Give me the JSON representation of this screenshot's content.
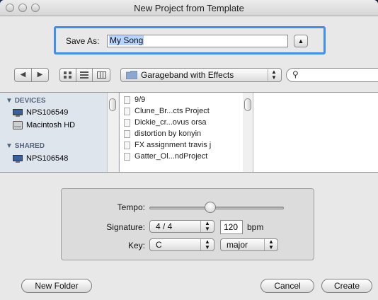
{
  "window": {
    "title": "New Project from Template"
  },
  "save_as": {
    "label": "Save As:",
    "value": "My Song"
  },
  "toolbar": {
    "back_icon": "back-arrow-icon",
    "forward_icon": "forward-arrow-icon",
    "view_icons": [
      "icon-view-icon",
      "list-view-icon",
      "column-view-icon"
    ],
    "location": "Garageband with Effects",
    "search_placeholder": ""
  },
  "sidebar": {
    "devices_header": "DEVICES",
    "devices": [
      "NPS106549",
      "Macintosh HD"
    ],
    "shared_header": "SHARED",
    "shared": [
      "NPS106548"
    ]
  },
  "files": [
    "9/9",
    "Clune_Br...cts Project",
    "Dickie_cr...ovus orsa",
    "distortion by konyin",
    "FX assignment travis j",
    "Gatter_Ol...ndProject"
  ],
  "project_settings": {
    "tempo_label": "Tempo:",
    "tempo_position": 0.45,
    "signature_label": "Signature:",
    "signature": "4 / 4",
    "bpm_value": "120",
    "bpm_unit": "bpm",
    "key_label": "Key:",
    "key": "C",
    "scale": "major"
  },
  "buttons": {
    "new_folder": "New Folder",
    "cancel": "Cancel",
    "create": "Create"
  },
  "colors": {
    "focus_ring": "#3d8ef0",
    "selection": "#b5d4fe",
    "sidebar_header": "#55657d"
  }
}
